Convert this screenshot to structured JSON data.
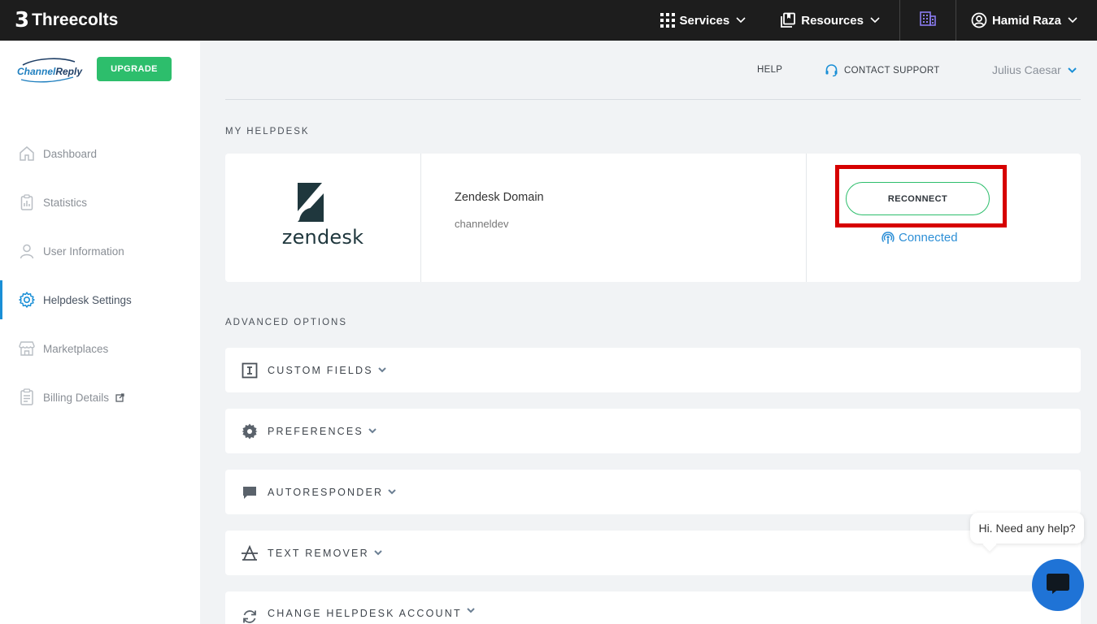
{
  "topbar": {
    "brand_mark": "3",
    "brand_name": "Threecolts",
    "services": "Services",
    "resources": "Resources",
    "user": "Hamid Raza"
  },
  "sidebar": {
    "logo_part1": "Channel",
    "logo_part2": "Reply",
    "upgrade": "UPGRADE",
    "items": [
      {
        "label": "Dashboard",
        "icon": "home-icon"
      },
      {
        "label": "Statistics",
        "icon": "clipboard-chart-icon"
      },
      {
        "label": "User Information",
        "icon": "user-icon"
      },
      {
        "label": "Helpdesk Settings",
        "icon": "gear-icon",
        "active": true
      },
      {
        "label": "Marketplaces",
        "icon": "store-icon"
      },
      {
        "label": "Billing Details",
        "icon": "billing-icon",
        "external": true
      }
    ]
  },
  "header": {
    "help": "HELP",
    "contact_support": "CONTACT SUPPORT",
    "user": "Julius Caesar"
  },
  "helpdesk": {
    "section_title": "MY HELPDESK",
    "logo_text": "zendesk",
    "domain_label": "Zendesk Domain",
    "domain_value": "channeldev",
    "reconnect": "RECONNECT",
    "status": "Connected"
  },
  "advanced": {
    "section_title": "ADVANCED OPTIONS",
    "options": [
      {
        "label": "CUSTOM FIELDS",
        "icon": "text-field-icon"
      },
      {
        "label": "PREFERENCES",
        "icon": "gear-icon"
      },
      {
        "label": "AUTORESPONDER",
        "icon": "chat-icon"
      },
      {
        "label": "TEXT REMOVER",
        "icon": "strikethrough-icon"
      },
      {
        "label": "CHANGE HELPDESK ACCOUNT",
        "icon": "refresh-icon"
      }
    ]
  },
  "chat": {
    "prompt": "Hi. Need any help?"
  },
  "colors": {
    "accent_green": "#2dbe6c",
    "accent_blue": "#1a8fd6",
    "highlight_red": "#d60000",
    "chat_blue": "#1f73d6"
  }
}
